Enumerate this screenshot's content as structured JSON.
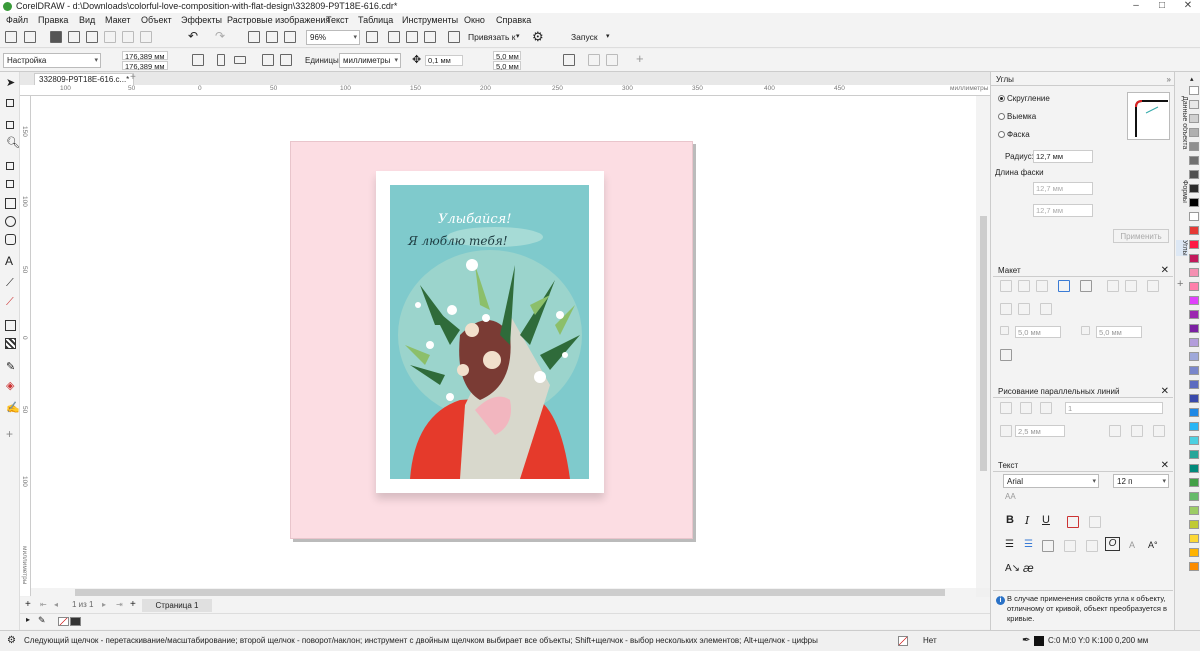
{
  "app": {
    "title": "CorelDRAW - d:\\Downloads\\colorful-love-composition-with-flat-design\\332809-P9T18E-616.cdr*"
  },
  "menu": [
    "Файл",
    "Правка",
    "Вид",
    "Макет",
    "Объект",
    "Эффекты",
    "Растровые изображения",
    "Текст",
    "Таблица",
    "Инструменты",
    "Окно",
    "Справка"
  ],
  "toolbar": {
    "zoom": "96%",
    "snap": "Привязать к",
    "launch": "Запуск"
  },
  "propbar": {
    "preset": "Настройка",
    "width": "176,389 мм",
    "height": "176,389 мм",
    "units_label": "Единицы:",
    "units": "миллиметры",
    "nudge": "0,1 мм",
    "dup_x": "5,0 мм",
    "dup_y": "5,0 мм"
  },
  "doc": {
    "tab": "332809-P9T18E-616.c...*",
    "ruler_unit": "миллиметры",
    "ruler_h": [
      "100",
      "50",
      "0",
      "50",
      "100",
      "150",
      "200",
      "250",
      "300",
      "350",
      "400",
      "450"
    ],
    "ruler_v": [
      "150",
      "100",
      "50",
      "0",
      "50",
      "100",
      "150",
      "200",
      "250",
      "300"
    ]
  },
  "artwork": {
    "line1": "Улыбайся!",
    "line2": "Я люблю тебя!",
    "bg_color": "#fcdde3",
    "card_color": "#7fcacc"
  },
  "pagebar": {
    "counter": "1 из 1",
    "page": "Страница 1"
  },
  "docker": {
    "corners": {
      "title": "Углы",
      "round": "Скругление",
      "scallop": "Выемка",
      "chamfer": "Фаска",
      "radius_label": "Радиус:",
      "radius": "12,7 мм",
      "chamfer_label": "Длина фаски",
      "chamfer_a": "12,7 мм",
      "chamfer_b": "12,7 мм",
      "apply": "Применить"
    },
    "layout": {
      "title": "Макет",
      "v1": "5,0 мм",
      "v2": "5,0 мм"
    },
    "parallel": {
      "title": "Рисование параллельных линий",
      "count": "1",
      "dist": "2,5 мм"
    },
    "text": {
      "title": "Текст",
      "font": "Arial",
      "size": "12 п"
    },
    "info": "В случае применения свойств угла к объекту, отличному от кривой, объект преобразуется в кривые."
  },
  "side_tabs": [
    "Данные объекта",
    "Формы",
    "Углы"
  ],
  "status": {
    "hint": "Следующий щелчок - перетаскивание/масштабирование; второй щелчок - поворот/наклон; инструмент с двойным щелчком выбирает все объекты; Shift+щелчок - выбор нескольких элементов; Alt+щелчок - цифры",
    "fill": "Нет",
    "outline": "C:0 M:0 Y:0 K:100  0,200 мм"
  },
  "palette": [
    "#ffffff",
    "#e8e8e8",
    "#d0d0d0",
    "#b0b0b0",
    "#909090",
    "#707070",
    "#505050",
    "#2a2a2a",
    "#000000",
    "#ffffff",
    "#e53935",
    "#ff1744",
    "#c2185b",
    "#f48fb1",
    "#ff80ab",
    "#e040fb",
    "#9c27b0",
    "#7b1fa2",
    "#b39ddb",
    "#9fa8da",
    "#7986cb",
    "#5c6bc0",
    "#3949ab",
    "#1e88e5",
    "#29b6f6",
    "#4dd0e1",
    "#26a69a",
    "#00897b",
    "#43a047",
    "#66bb6a",
    "#9ccc65",
    "#c0ca33",
    "#fdd835",
    "#ffb300",
    "#fb8c00"
  ]
}
